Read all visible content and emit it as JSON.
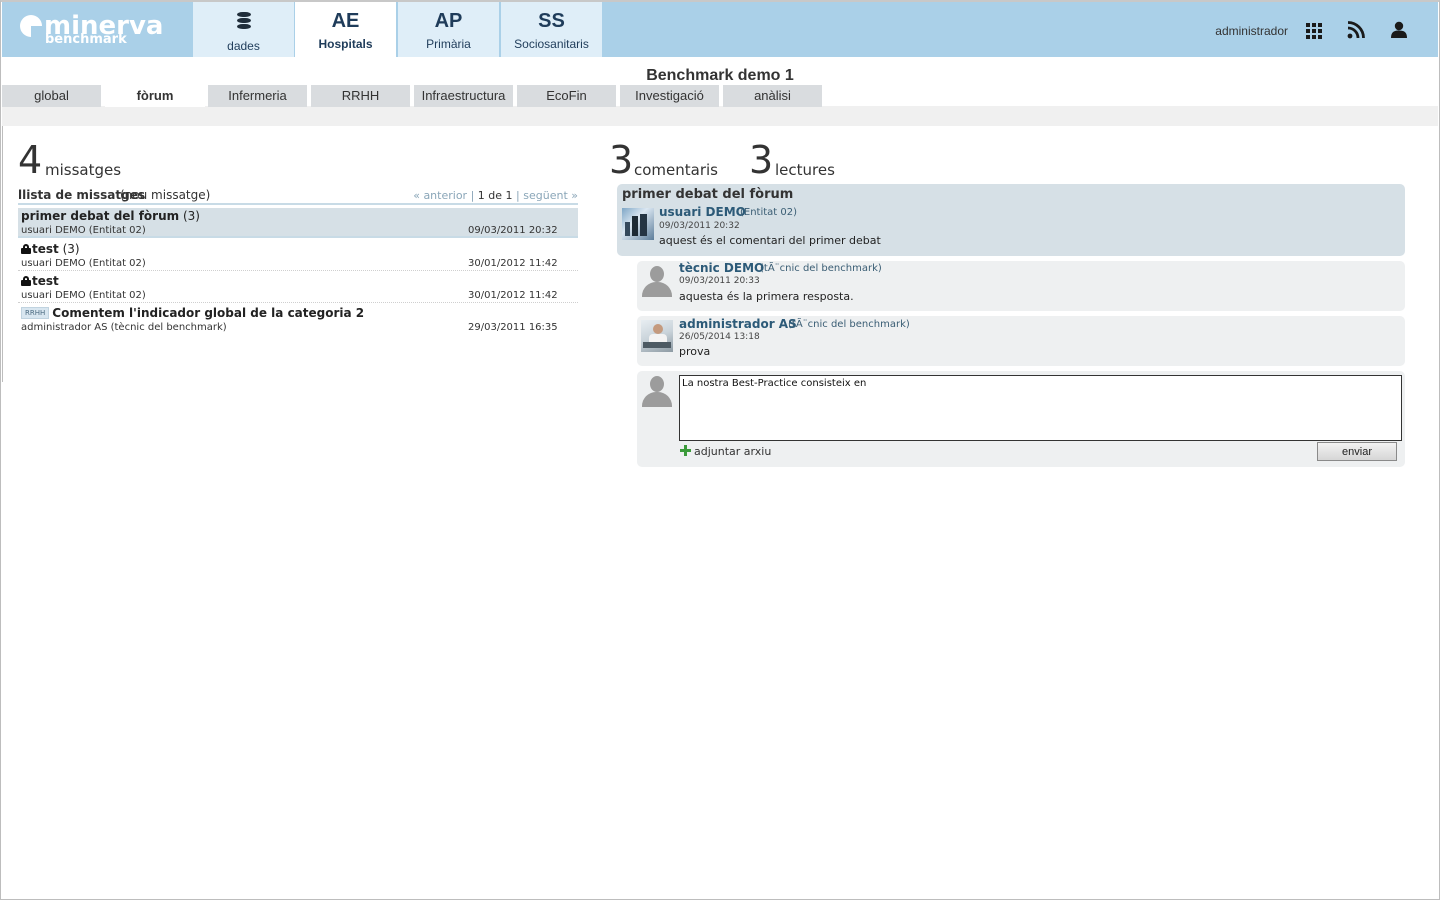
{
  "app": {
    "logo_text": "minerva",
    "logo_sub": "benchmark",
    "page_title": "Benchmark demo 1"
  },
  "modules": [
    {
      "code": "",
      "label": "dades",
      "icon": "database-icon"
    },
    {
      "code": "AE",
      "label": "Hospitals"
    },
    {
      "code": "AP",
      "label": "Primària"
    },
    {
      "code": "SS",
      "label": "Sociosanitaris"
    }
  ],
  "header": {
    "user_name": "administrador",
    "icons": [
      "grid-icon",
      "rss-icon",
      "user-icon"
    ]
  },
  "subtabs": [
    "global",
    "fòrum",
    "Infermeria",
    "RRHH",
    "Infraestructura",
    "EcoFin",
    "Investigació",
    "anàlisi"
  ],
  "active_subtab": "fòrum",
  "left": {
    "count": "4",
    "count_label": "missatges",
    "list_title": "llista de missatges",
    "new_message": "(nou missatge)",
    "pager": {
      "prev": "« anterior",
      "sep1": "|",
      "current": "1 de 1",
      "sep2": "|",
      "next": "següent »"
    },
    "messages": [
      {
        "title": "primer debat del fòrum",
        "count": "(3)",
        "author": "usuari DEMO (Entitat 02)",
        "date": "09/03/2011 20:32",
        "selected": true,
        "locked": false
      },
      {
        "title": "test",
        "count": "(3)",
        "author": "usuari DEMO (Entitat 02)",
        "date": "30/01/2012 11:42",
        "selected": false,
        "locked": true
      },
      {
        "title": "test",
        "count": "",
        "author": "usuari DEMO (Entitat 02)",
        "date": "30/01/2012 11:42",
        "selected": false,
        "locked": true
      },
      {
        "title": "Comentem l'indicador global de la categoria 2",
        "count": "",
        "tag": "RRHH",
        "author": "administrador AS (tècnic del benchmark)",
        "date": "29/03/2011 16:35",
        "selected": false,
        "locked": false
      }
    ]
  },
  "right": {
    "comments_count": "3",
    "comments_label": "comentaris",
    "reads_count": "3",
    "reads_label": "lectures",
    "thread_title": "primer debat del fòrum",
    "original": {
      "name": "usuari DEMO",
      "org": "(Entitat 02)",
      "date": "09/03/2011 20:32",
      "text": "aquest és el comentari del primer debat"
    },
    "replies": [
      {
        "name": "tècnic DEMO",
        "org": "(tÃ¨cnic del benchmark)",
        "date": "09/03/2011 20:33",
        "text": "aquesta és la primera resposta."
      },
      {
        "name": "administrador AS",
        "org": "(tÃ¨cnic del benchmark)",
        "date": "26/05/2014 13:18",
        "text": "prova"
      }
    ],
    "reply_value": "La nostra Best-Practice consisteix en",
    "attach_label": "adjuntar arxiu",
    "send_label": "enviar"
  },
  "colors": {
    "header_bg": "#aad0e8",
    "selected_row": "#d6e0e6",
    "link": "#2c5a78"
  }
}
